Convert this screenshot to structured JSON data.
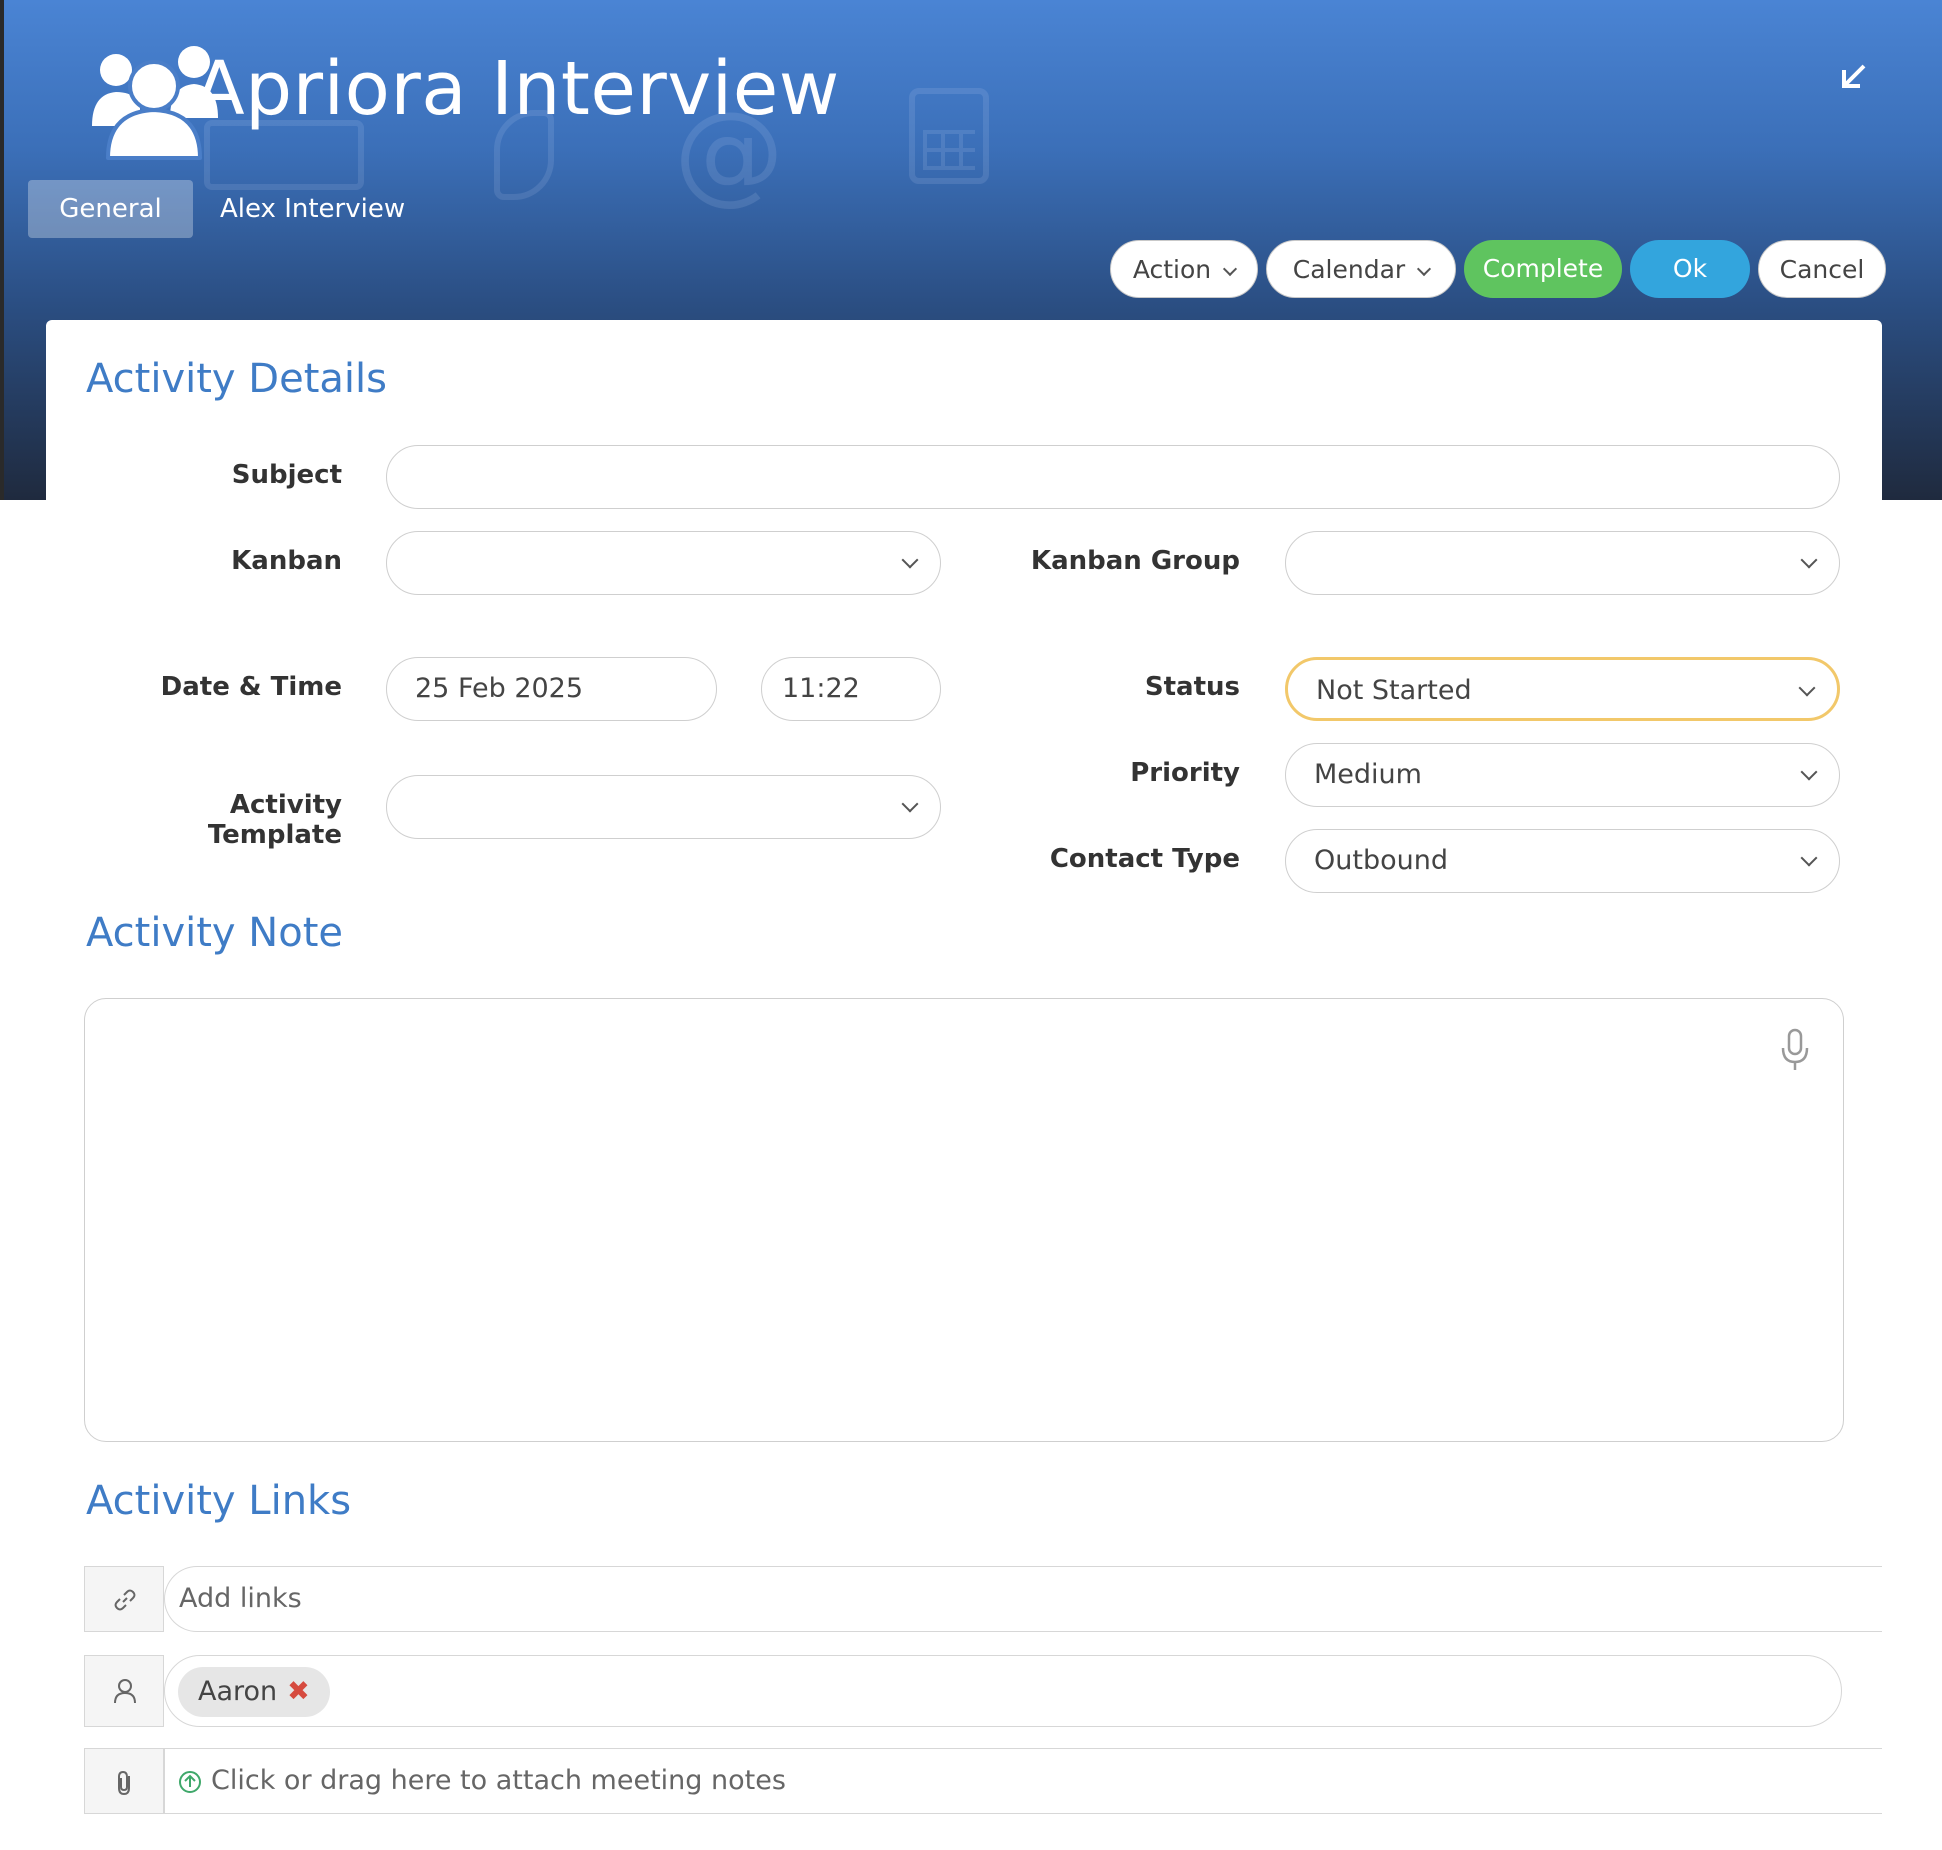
{
  "window": {
    "title": "Apriora Interview"
  },
  "tabs": [
    {
      "label": "General",
      "active": true
    },
    {
      "label": "Alex Interview",
      "active": false
    }
  ],
  "toolbar": {
    "action_label": "Action",
    "calendar_label": "Calendar",
    "complete_label": "Complete",
    "ok_label": "Ok",
    "cancel_label": "Cancel"
  },
  "activity_details": {
    "section_title": "Activity Details",
    "subject": {
      "label": "Subject",
      "value": ""
    },
    "kanban": {
      "label": "Kanban",
      "value": ""
    },
    "kanban_group": {
      "label": "Kanban Group",
      "value": ""
    },
    "date_time": {
      "label": "Date & Time",
      "date": "25 Feb 2025",
      "time": "11:22"
    },
    "status": {
      "label": "Status",
      "value": "Not Started"
    },
    "activity_template": {
      "label": "Activity Template",
      "value": ""
    },
    "priority": {
      "label": "Priority",
      "value": "Medium"
    },
    "contact_type": {
      "label": "Contact Type",
      "value": "Outbound"
    }
  },
  "activity_note": {
    "section_title": "Activity Note",
    "value": ""
  },
  "activity_links": {
    "section_title": "Activity Links",
    "links_placeholder": "Add links",
    "contacts": [
      {
        "name": "Aaron"
      }
    ],
    "attach_text": "Click or drag here to attach meeting notes"
  },
  "icons": [
    "users-icon",
    "minimize-icon",
    "microphone-icon",
    "link-icon",
    "person-icon",
    "paperclip-icon",
    "upload-cloud-icon",
    "remove-icon"
  ],
  "colors": {
    "section_title": "#3f7cc6",
    "complete_button": "#5fc45f",
    "ok_button": "#33a5dd",
    "status_focus_border": "#f2c86a",
    "chip_remove": "#d64b3f"
  }
}
